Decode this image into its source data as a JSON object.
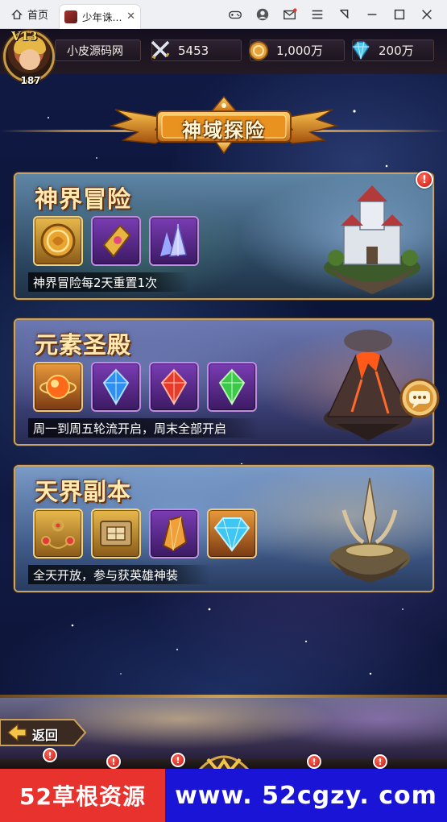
{
  "browser": {
    "home_tab": "首页",
    "game_tab": "少年诛...",
    "close_glyph": "✕"
  },
  "topbar": {
    "vip": "V13",
    "level": "187",
    "player_name": "小皮源码网",
    "power": "5453",
    "gold": "1,000万",
    "diamonds": "200万"
  },
  "banner": {
    "title": "神域探险"
  },
  "cards": [
    {
      "title": "神界冒险",
      "desc": "神界冒险每2天重置1次",
      "items": [
        "gold-coin-icon",
        "gold-token-icon",
        "crystal-icon"
      ],
      "has_alert": true
    },
    {
      "title": "元素圣殿",
      "desc": "周一到周五轮流开启，周末全部开启",
      "items": [
        "fire-orb-icon",
        "water-gem-icon",
        "fire-gem-icon",
        "earth-gem-icon"
      ]
    },
    {
      "title": "天界副本",
      "desc": "全天开放，参与获英雄神装",
      "items": [
        "ring-set-icon",
        "scroll-box-icon",
        "amber-crystal-icon",
        "diamond-icon"
      ]
    }
  ],
  "alert_glyph": "!",
  "bottom": {
    "back_label": "返回"
  },
  "watermark": {
    "left": "52草根资源",
    "right": "www. 52cgzy. com"
  },
  "colors": {
    "card_border": "#c7a36b",
    "title_gold": "#ffe9b0",
    "alert_red": "#e0201a",
    "wm_red": "#e8322d",
    "wm_blue": "#1a14d6"
  }
}
